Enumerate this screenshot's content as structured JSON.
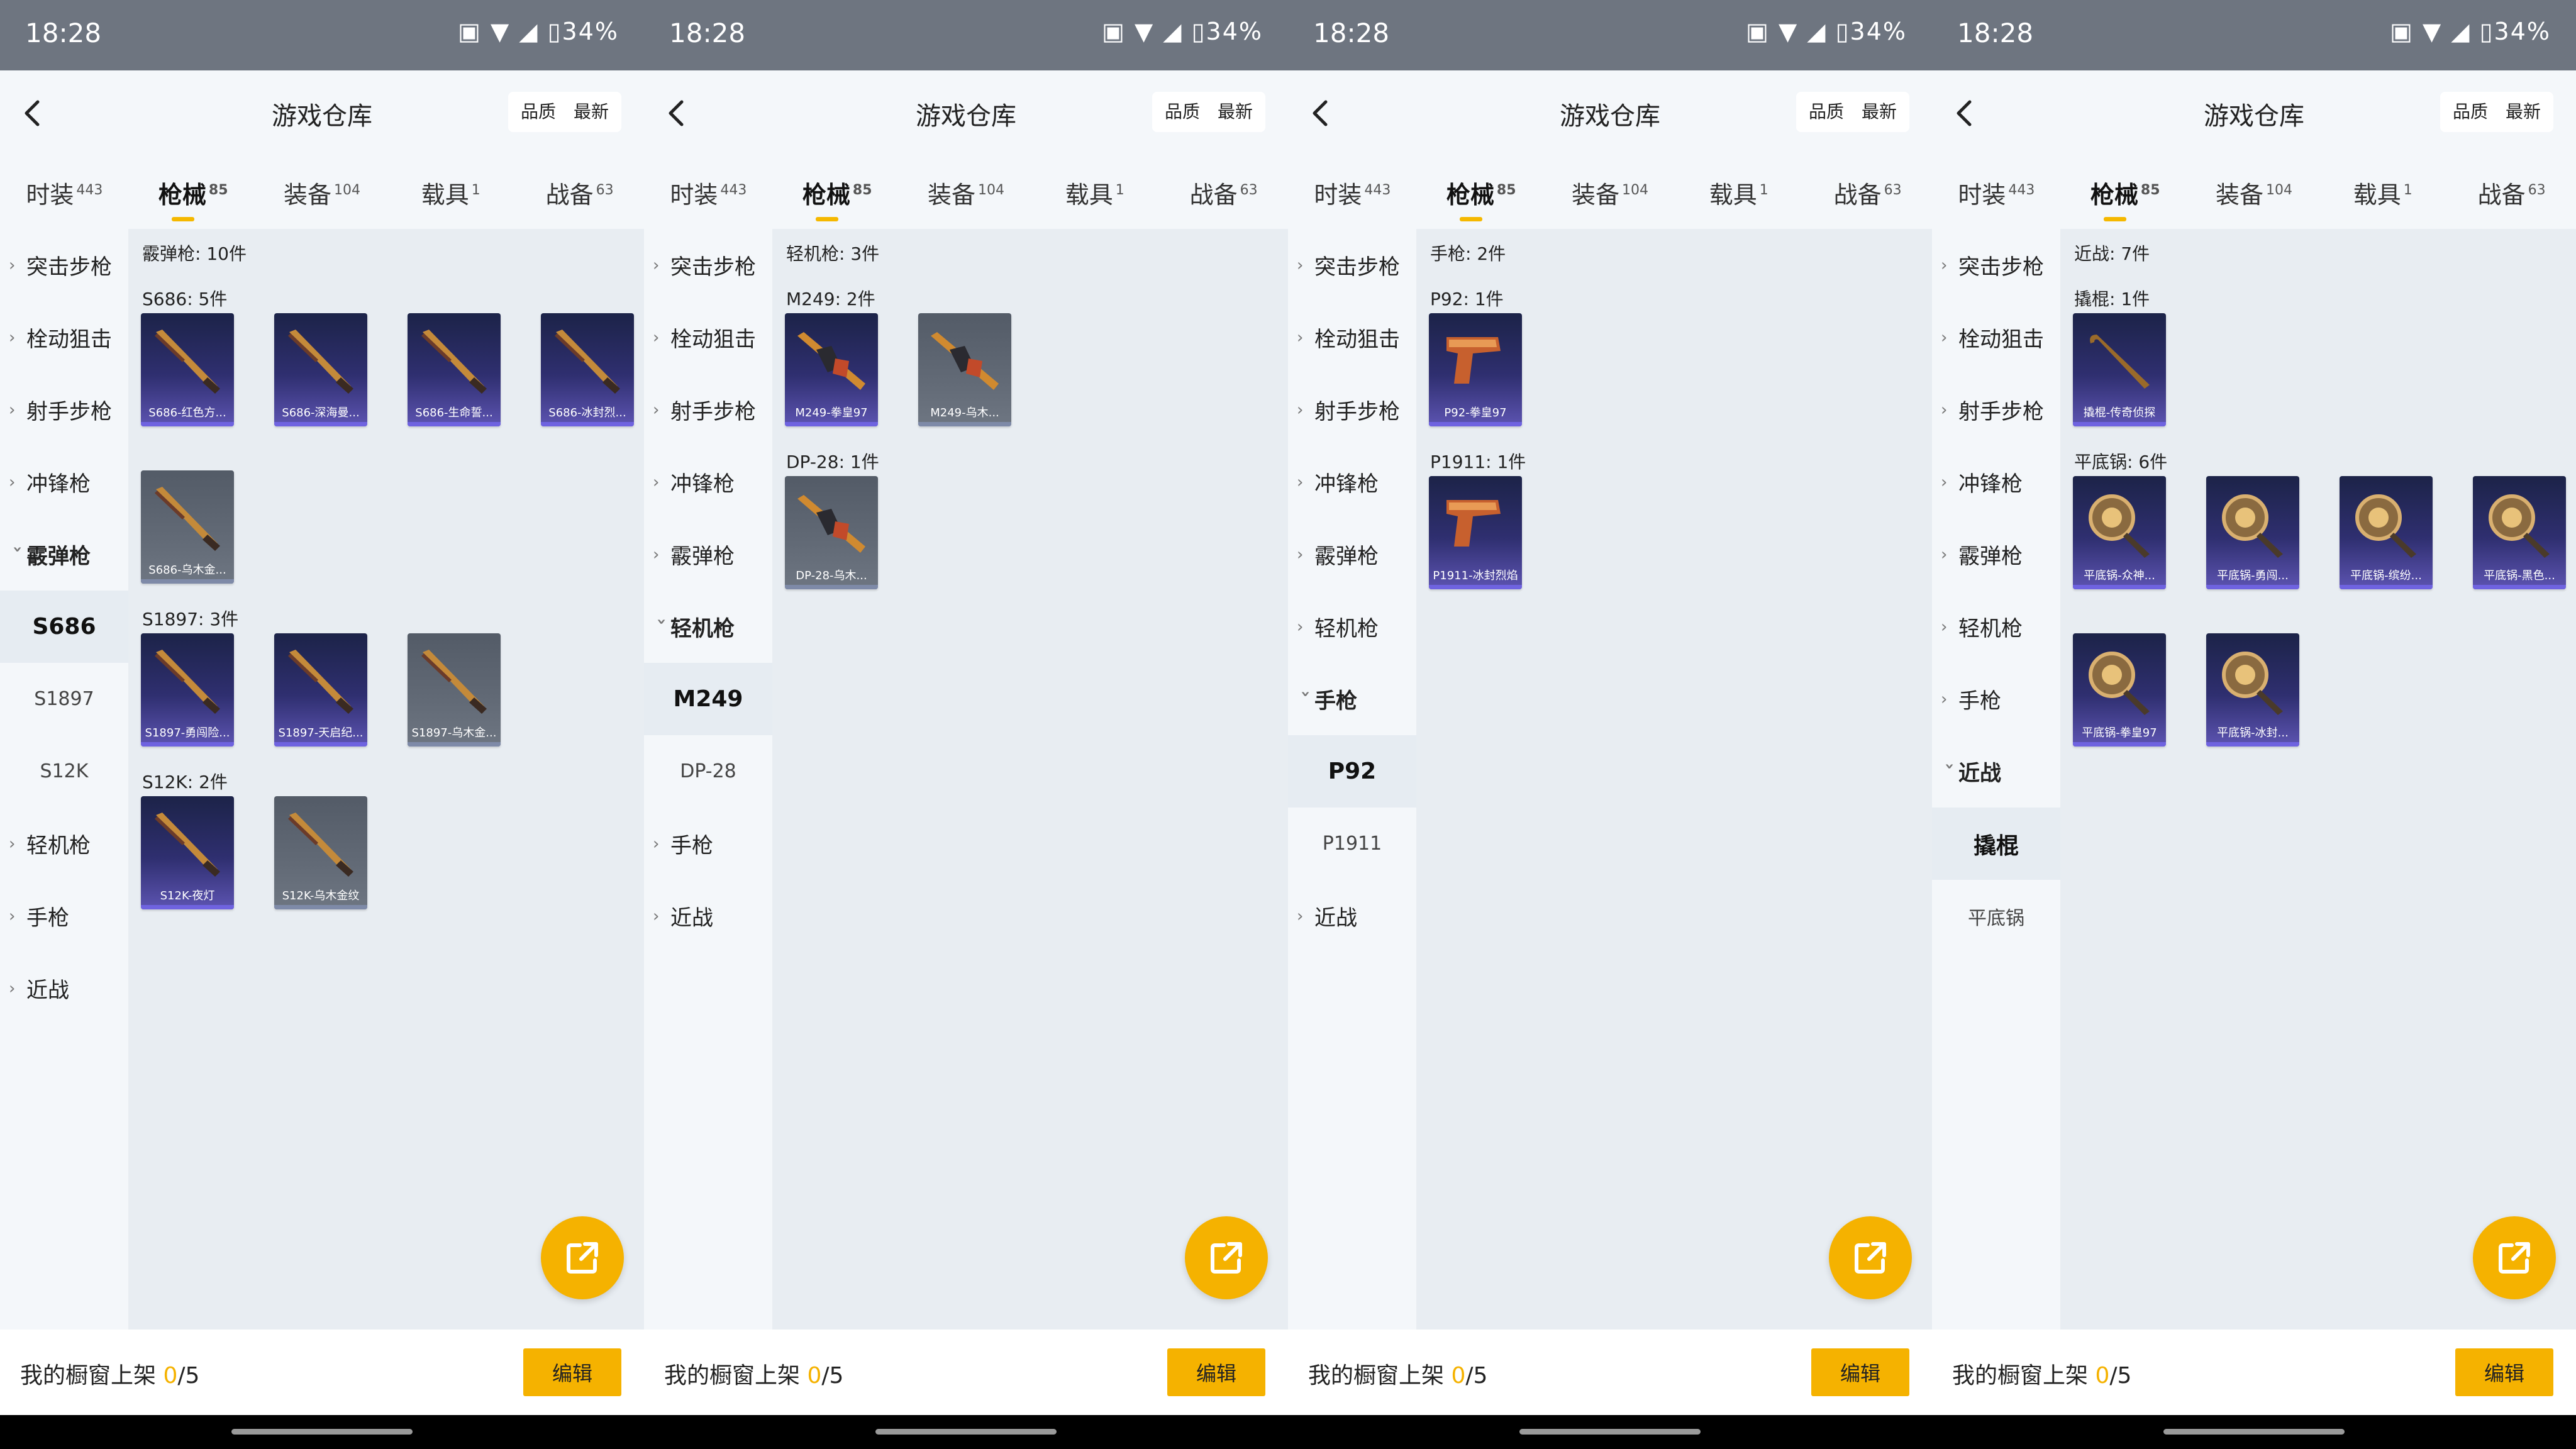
{
  "status": {
    "time": "18:28",
    "battery": "34%"
  },
  "header": {
    "title": "游戏仓库",
    "sort_quality": "品质",
    "sort_latest": "最新"
  },
  "tabs": [
    {
      "label": "时装",
      "count": "443"
    },
    {
      "label": "枪械",
      "count": "85"
    },
    {
      "label": "装备",
      "count": "104"
    },
    {
      "label": "载具",
      "count": "1"
    },
    {
      "label": "战备",
      "count": "63"
    }
  ],
  "categories": {
    "assault": "突击步枪",
    "sniper": "栓动狙击",
    "marksman": "射手步枪",
    "smg": "冲锋枪",
    "shotgun": "霰弹枪",
    "lmg": "轻机枪",
    "pistol": "手枪",
    "melee": "近战"
  },
  "panels": [
    {
      "subs": [
        "S686",
        "S1897",
        "S12K"
      ],
      "content_head": "霰弹枪: 10件",
      "groups": [
        {
          "label": "S686: 5件",
          "items": [
            {
              "name": "S686-红色方...",
              "tone": "purple"
            },
            {
              "name": "S686-深海曼...",
              "tone": "purple"
            },
            {
              "name": "S686-生命誓...",
              "tone": "purple"
            },
            {
              "name": "S686-冰封烈...",
              "tone": "purple"
            },
            {
              "name": "S686-乌木金...",
              "tone": "gray"
            }
          ]
        },
        {
          "label": "S1897: 3件",
          "items": [
            {
              "name": "S1897-勇闯险...",
              "tone": "purple"
            },
            {
              "name": "S1897-天启纪...",
              "tone": "purple"
            },
            {
              "name": "S1897-乌木金...",
              "tone": "gray"
            }
          ]
        },
        {
          "label": "S12K: 2件",
          "items": [
            {
              "name": "S12K-夜灯",
              "tone": "purple"
            },
            {
              "name": "S12K-乌木金纹",
              "tone": "gray"
            }
          ]
        }
      ]
    },
    {
      "subs": [
        "M249",
        "DP-28"
      ],
      "content_head": "轻机枪: 3件",
      "groups": [
        {
          "label": "M249: 2件",
          "items": [
            {
              "name": "M249-拳皇97",
              "tone": "purple"
            },
            {
              "name": "M249-乌木...",
              "tone": "gray"
            }
          ]
        },
        {
          "label": "DP-28: 1件",
          "items": [
            {
              "name": "DP-28-乌木...",
              "tone": "gray"
            }
          ]
        }
      ]
    },
    {
      "subs": [
        "P92",
        "P1911"
      ],
      "content_head": "手枪: 2件",
      "groups": [
        {
          "label": "P92: 1件",
          "items": [
            {
              "name": "P92-拳皇97",
              "tone": "purple"
            }
          ]
        },
        {
          "label": "P1911: 1件",
          "items": [
            {
              "name": "P1911-冰封烈焰",
              "tone": "purple"
            }
          ]
        }
      ]
    },
    {
      "subs": [
        "撬棍",
        "平底锅"
      ],
      "content_head": "近战: 7件",
      "groups": [
        {
          "label": "撬棍: 1件",
          "items": [
            {
              "name": "撬棍-传奇侦探",
              "tone": "purple"
            }
          ]
        },
        {
          "label": "平底锅: 6件",
          "items": [
            {
              "name": "平底锅-众神...",
              "tone": "purple"
            },
            {
              "name": "平底锅-勇闯...",
              "tone": "purple"
            },
            {
              "name": "平底锅-缤纷...",
              "tone": "purple"
            },
            {
              "name": "平底锅-黑色...",
              "tone": "purple"
            },
            {
              "name": "平底锅-拳皇97",
              "tone": "purple"
            },
            {
              "name": "平底锅-冰封...",
              "tone": "purple"
            }
          ]
        }
      ]
    }
  ],
  "bottom": {
    "label_prefix": "我的橱窗上架 ",
    "count": "0",
    "total": "/5",
    "edit": "编辑"
  },
  "colors": {
    "accent": "#f5b200",
    "rare_purple": "#5d54b2",
    "common_gray": "#626a76"
  }
}
